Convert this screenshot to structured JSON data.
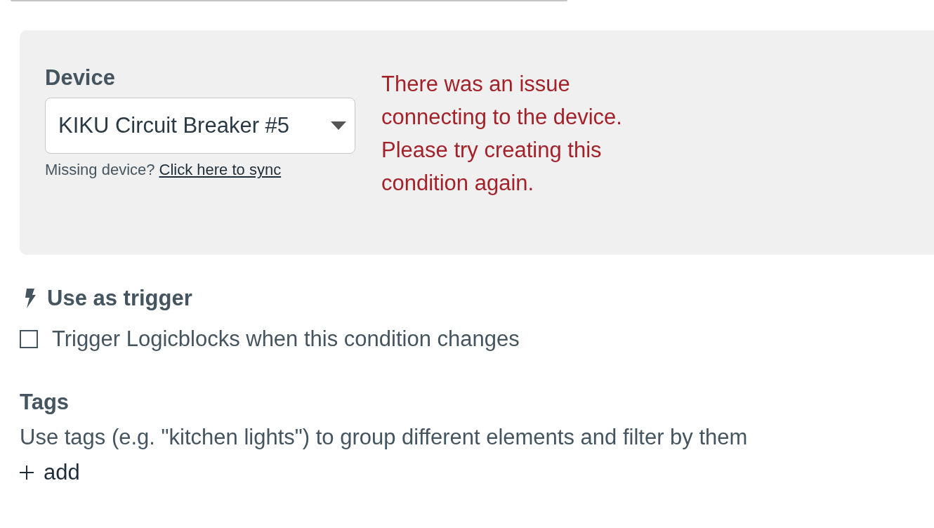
{
  "device_panel": {
    "label": "Device",
    "select_value": "KIKU Circuit Breaker #5",
    "hint": "Missing device?",
    "sync_link": "Click here to sync",
    "error": "There was an issue connecting to the device. Please try creating this condition again."
  },
  "trigger": {
    "heading": "Use as trigger",
    "checkbox_label": "Trigger Logicblocks when this condition changes",
    "checked": false
  },
  "tags": {
    "heading": "Tags",
    "description": "Use tags (e.g. \"kitchen lights\") to group different elements and filter by them",
    "add_label": "add"
  }
}
